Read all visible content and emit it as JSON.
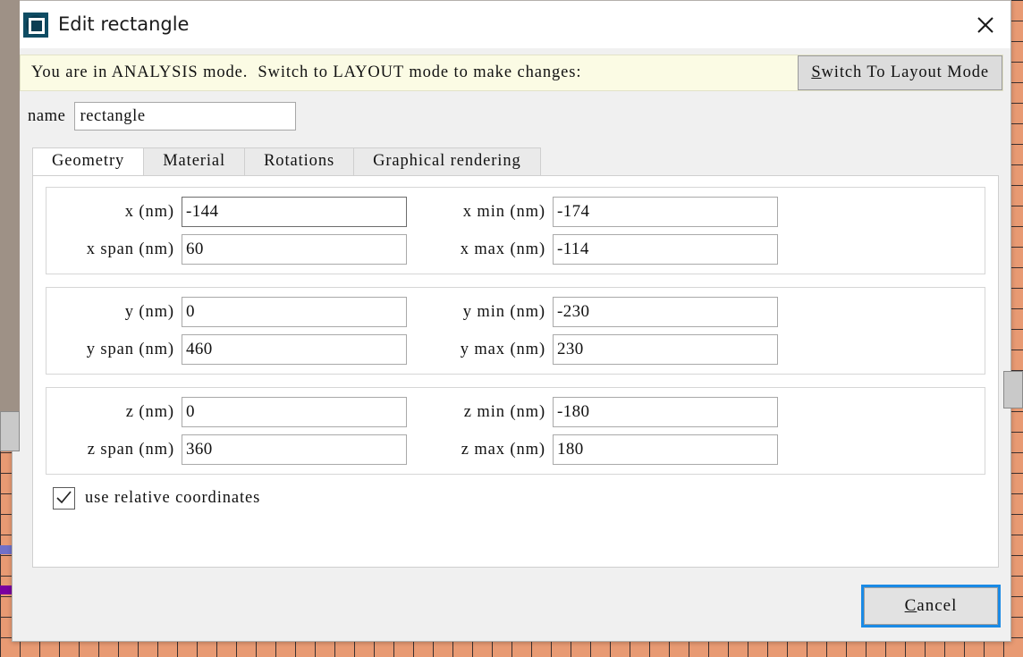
{
  "window": {
    "title": "Edit rectangle",
    "icon": "rectangle-app-icon",
    "close_icon": "close-icon"
  },
  "banner": {
    "message": "You are in ANALYSIS mode.  Switch to LAYOUT mode to make changes:",
    "button_mnemonic": "S",
    "button_rest": "witch To Layout Mode",
    "background_color": "#fbfbe4"
  },
  "name_field": {
    "label": "name",
    "value": "rectangle",
    "placeholder": "name"
  },
  "tabs": [
    {
      "label": "Geometry",
      "active": true
    },
    {
      "label": "Material",
      "active": false
    },
    {
      "label": "Rotations",
      "active": false
    },
    {
      "label": "Graphical rendering",
      "active": false
    }
  ],
  "geometry": {
    "groups": [
      {
        "axis": "x",
        "rows": [
          {
            "left_label": "x  (nm)",
            "left_value": "-144",
            "left_focused": true,
            "right_label": "x min  (nm)",
            "right_value": "-174"
          },
          {
            "left_label": "x span  (nm)",
            "left_value": "60",
            "left_focused": false,
            "right_label": "x max  (nm)",
            "right_value": "-114"
          }
        ]
      },
      {
        "axis": "y",
        "rows": [
          {
            "left_label": "y  (nm)",
            "left_value": "0",
            "left_focused": false,
            "right_label": "y min  (nm)",
            "right_value": "-230"
          },
          {
            "left_label": "y span  (nm)",
            "left_value": "460",
            "left_focused": false,
            "right_label": "y max  (nm)",
            "right_value": "230"
          }
        ]
      },
      {
        "axis": "z",
        "rows": [
          {
            "left_label": "z  (nm)",
            "left_value": "0",
            "left_focused": false,
            "right_label": "z min  (nm)",
            "right_value": "-180"
          },
          {
            "left_label": "z span  (nm)",
            "left_value": "360",
            "left_focused": false,
            "right_label": "z max  (nm)",
            "right_value": "180"
          }
        ]
      }
    ],
    "use_relative": {
      "label": "use relative coordinates",
      "checked": true
    }
  },
  "footer": {
    "cancel_mnemonic": "C",
    "cancel_rest": "ancel",
    "focus_ring_color": "#1a8ae5"
  }
}
